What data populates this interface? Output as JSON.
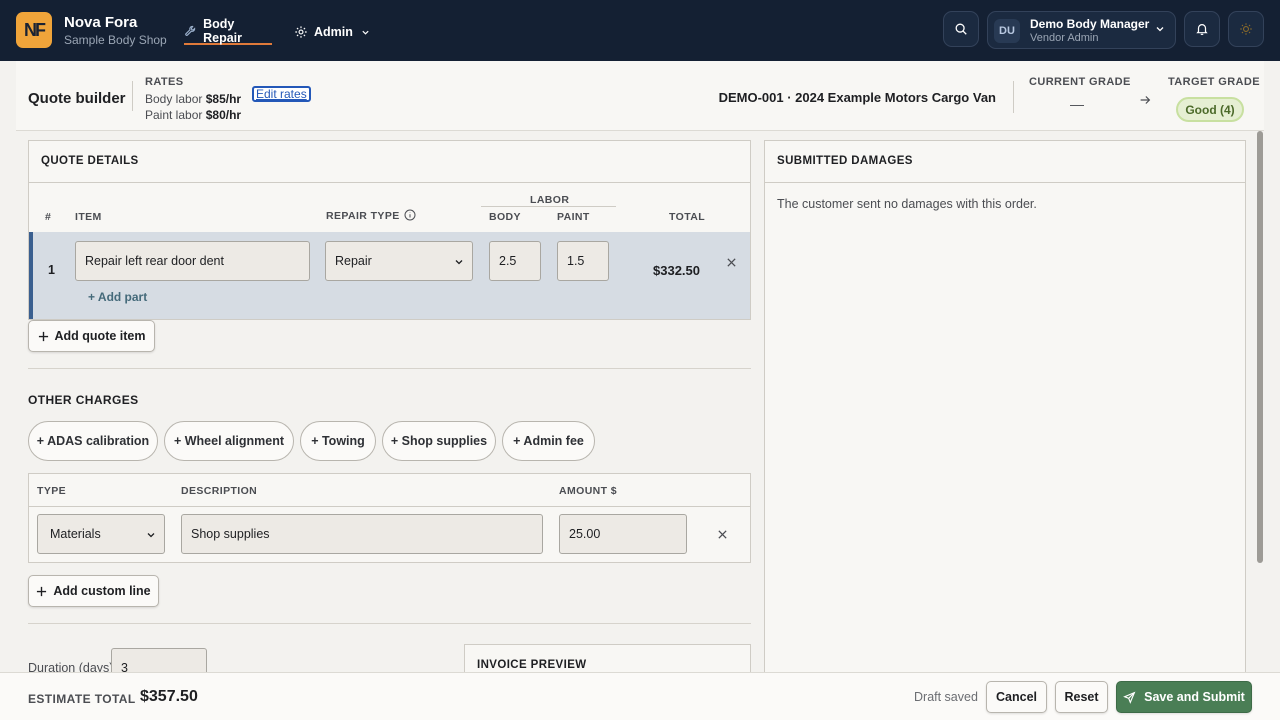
{
  "app": {
    "logo": "NF",
    "name": "Nova Fora",
    "subtitle": "Sample Body Shop"
  },
  "nav": {
    "body_repair": "Body Repair",
    "admin": "Admin"
  },
  "user": {
    "initials": "DU",
    "name": "Demo Body Manager",
    "role": "Vendor Admin"
  },
  "quote": {
    "title": "Quote builder",
    "rates_label": "RATES",
    "body_labor_label": "Body labor",
    "body_labor_rate": "$85/hr",
    "paint_labor_label": "Paint labor",
    "paint_labor_rate": "$80/hr",
    "edit_rates": "Edit rates",
    "vehicle": "DEMO-001 · 2024 Example Motors Cargo Van",
    "current_grade_label": "CURRENT GRADE",
    "current_grade": "—",
    "target_grade_label": "TARGET GRADE",
    "target_grade": "Good (4)"
  },
  "details": {
    "title": "QUOTE DETAILS",
    "col_num": "#",
    "col_item": "ITEM",
    "col_repair_type": "REPAIR TYPE",
    "col_labor": "LABOR",
    "col_body": "BODY",
    "col_paint": "PAINT",
    "col_total": "TOTAL",
    "items": [
      {
        "num": "1",
        "item": "Repair left rear door dent",
        "repair_type": "Repair",
        "body": "2.5",
        "paint": "1.5",
        "total": "$332.50"
      }
    ],
    "add_part": "+ Add part",
    "add_quote_item": "Add quote item"
  },
  "other_charges": {
    "title": "OTHER CHARGES",
    "pills": [
      "+ ADAS calibration",
      "+ Wheel alignment",
      "+ Towing",
      "+ Shop supplies",
      "+ Admin fee"
    ],
    "col_type": "TYPE",
    "col_description": "DESCRIPTION",
    "col_amount": "AMOUNT $",
    "lines": [
      {
        "type": "Materials",
        "description": "Shop supplies",
        "amount": "25.00"
      }
    ],
    "add_custom_line": "Add custom line"
  },
  "duration": {
    "label": "Duration (days)",
    "value": "3"
  },
  "invoice_preview": {
    "title": "INVOICE PREVIEW"
  },
  "damages": {
    "title": "SUBMITTED DAMAGES",
    "text": "The customer sent no damages with this order."
  },
  "footer": {
    "estimate_label": "ESTIMATE TOTAL",
    "estimate_total": "$357.50",
    "draft_status": "Draft saved",
    "cancel": "Cancel",
    "reset": "Reset",
    "submit": "Save and Submit"
  },
  "colors": {
    "topbar": "#142033",
    "accent_orange": "#f0a43a",
    "primary_green": "#4a7e55",
    "grade_green": "#e6efd3"
  }
}
